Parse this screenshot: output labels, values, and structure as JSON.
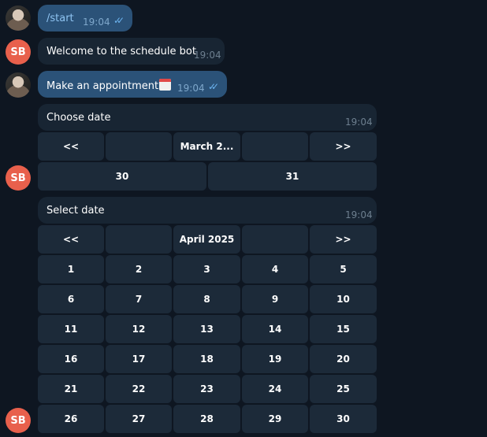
{
  "messages": {
    "start": {
      "text": "/start",
      "time": "19:04"
    },
    "welcome": {
      "text": "Welcome to the schedule bot",
      "time": "19:04"
    },
    "appointment": {
      "text": "Make an appointment",
      "time": "19:04"
    },
    "bot_initials": "SB"
  },
  "choose": {
    "title": "Choose date",
    "time": "19:04",
    "nav": {
      "prev": "<<",
      "month": "March 2...",
      "next": ">>"
    },
    "days": [
      "30",
      "31"
    ]
  },
  "select": {
    "title": "Select date",
    "time": "19:04",
    "nav": {
      "prev": "<<",
      "month": "April 2025",
      "next": ">>"
    },
    "days": [
      "1",
      "2",
      "3",
      "4",
      "5",
      "6",
      "7",
      "8",
      "9",
      "10",
      "11",
      "12",
      "13",
      "14",
      "15",
      "16",
      "17",
      "18",
      "19",
      "20",
      "21",
      "22",
      "23",
      "24",
      "25",
      "26",
      "27",
      "28",
      "29",
      "30"
    ]
  },
  "colors": {
    "background": "#0e1621",
    "outgoing_bubble": "#2b5278",
    "incoming_bubble": "#182533",
    "keyboard_button": "#1c2a39",
    "bot_avatar": "#e8604c",
    "read_checks": "#6bb3ef"
  }
}
